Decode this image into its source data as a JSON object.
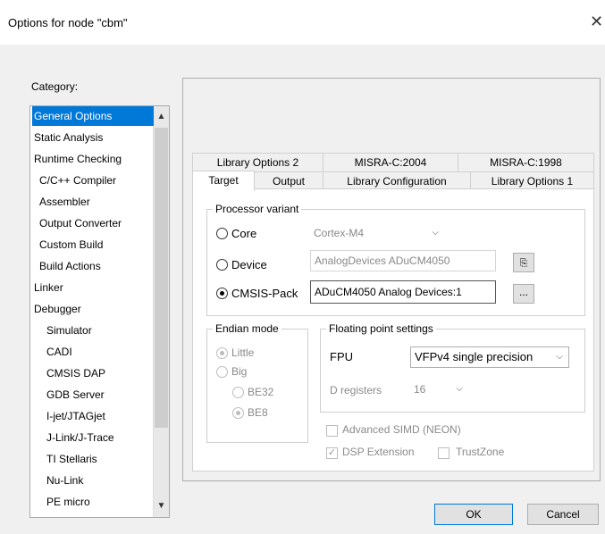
{
  "window": {
    "title": "Options for node \"cbm\"",
    "close_symbol": "✕"
  },
  "category": {
    "label": "Category:",
    "items": [
      "General Options",
      "Static Analysis",
      "Runtime Checking",
      "C/C++ Compiler",
      "Assembler",
      "Output Converter",
      "Custom Build",
      "Build Actions",
      "Linker",
      "Debugger",
      "Simulator",
      "CADI",
      "CMSIS DAP",
      "GDB Server",
      "I-jet/JTAGjet",
      "J-Link/J-Trace",
      "TI Stellaris",
      "Nu-Link",
      "PE micro"
    ],
    "selected": "General Options"
  },
  "tabs": {
    "row1": [
      "Library Options 2",
      "MISRA-C:2004",
      "MISRA-C:1998"
    ],
    "row2": [
      "Target",
      "Output",
      "Library Configuration",
      "Library Options 1"
    ],
    "active": "Target"
  },
  "processor": {
    "legend": "Processor variant",
    "core_label": "Core",
    "core_value": "Cortex-M4",
    "device_label": "Device",
    "device_value": "AnalogDevices ADuCM4050",
    "cmsis_label": "CMSIS-Pack",
    "cmsis_value": "ADuCM4050 Analog Devices:1",
    "browse_label": "...",
    "selected": "CMSIS-Pack"
  },
  "endian": {
    "legend": "Endian mode",
    "little": "Little",
    "big": "Big",
    "be32": "BE32",
    "be8": "BE8"
  },
  "fpu": {
    "legend": "Floating point settings",
    "fpu_label": "FPU",
    "fpu_value": "VFPv4 single precision",
    "dregs_label": "D registers",
    "dregs_value": "16"
  },
  "options": {
    "simd": "Advanced SIMD (NEON)",
    "dsp": "DSP Extension",
    "trustzone": "TrustZone"
  },
  "buttons": {
    "ok": "OK",
    "cancel": "Cancel"
  }
}
